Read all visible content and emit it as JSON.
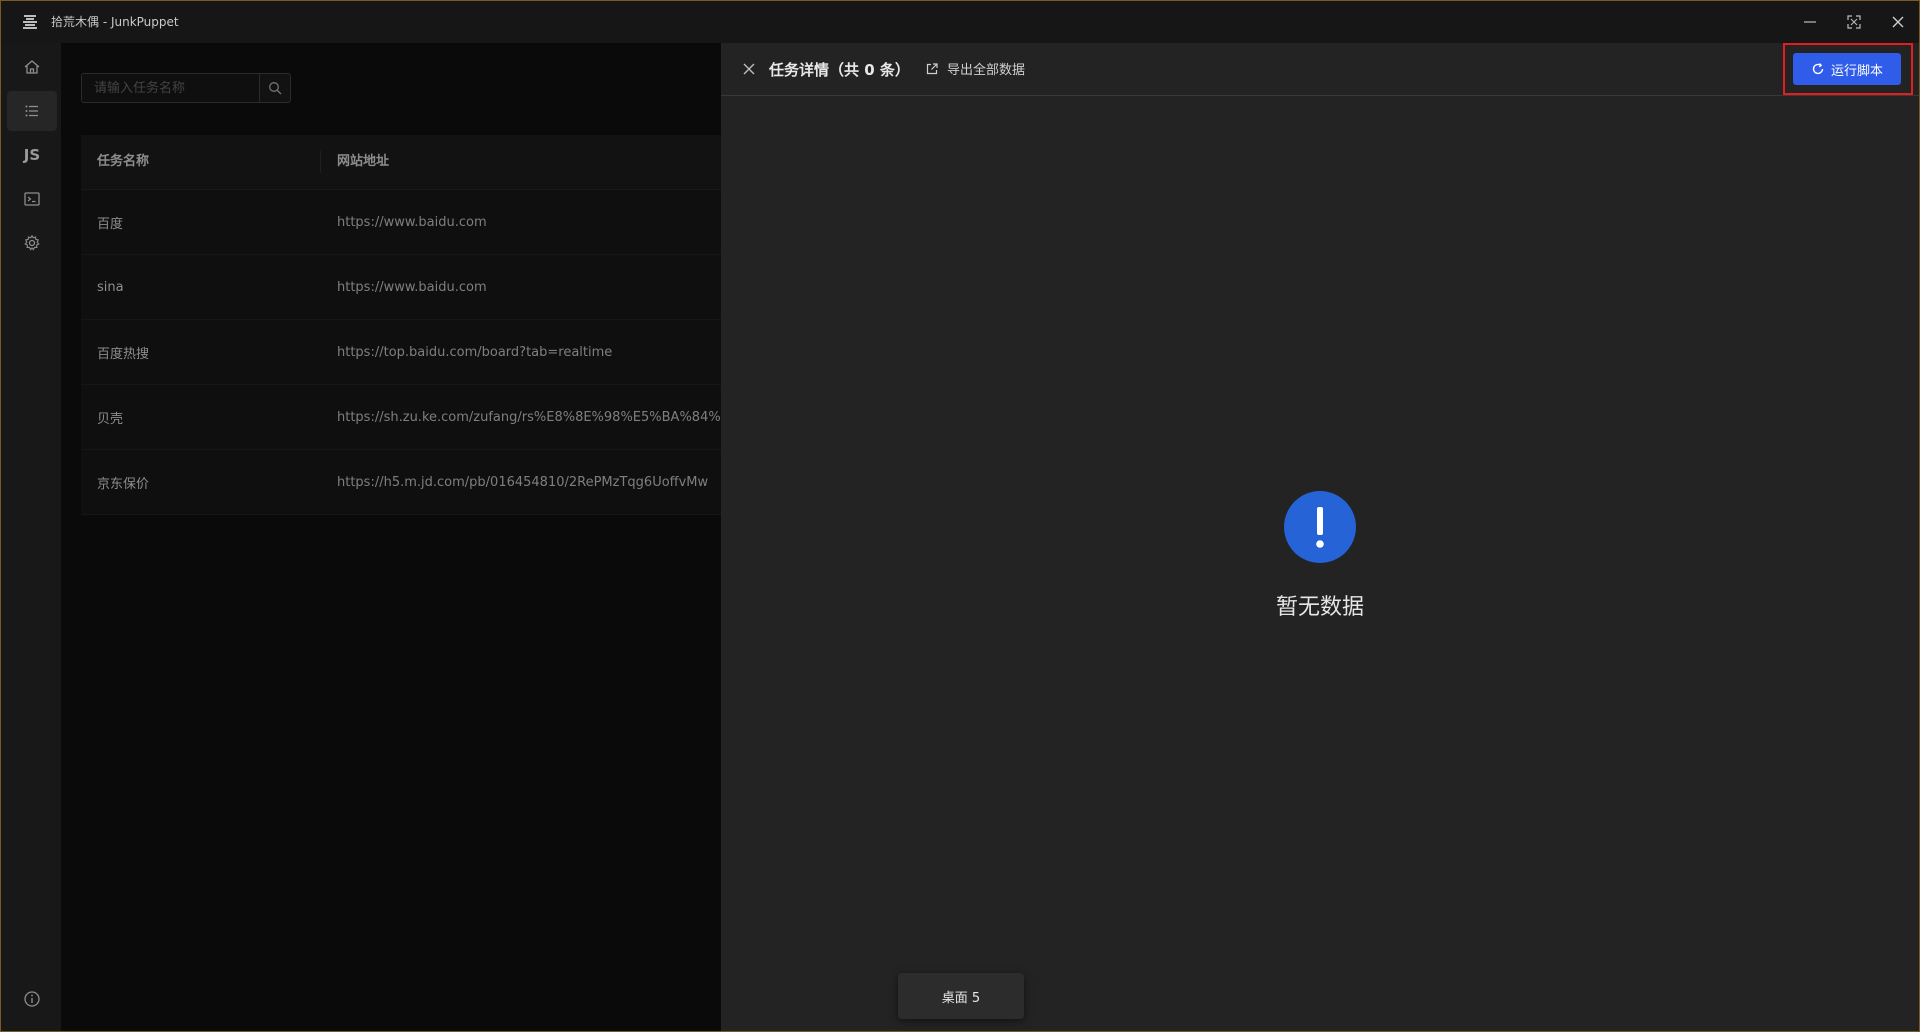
{
  "window": {
    "title": "拾荒木偶 - JunkPuppet"
  },
  "sidebar": {
    "items": [
      {
        "name": "home",
        "icon": "home-icon"
      },
      {
        "name": "task-list",
        "icon": "list-icon",
        "active": true
      },
      {
        "name": "js",
        "label": "JS"
      },
      {
        "name": "terminal",
        "icon": "terminal-icon"
      },
      {
        "name": "settings",
        "icon": "gear-icon"
      }
    ],
    "info_icon": "info-icon"
  },
  "search": {
    "placeholder": "请输入任务名称",
    "value": ""
  },
  "table": {
    "columns": [
      "任务名称",
      "网站地址"
    ],
    "rows": [
      {
        "name": "百度",
        "url": "https://www.baidu.com"
      },
      {
        "name": "sina",
        "url": "https://www.baidu.com"
      },
      {
        "name": "百度热搜",
        "url": "https://top.baidu.com/board?tab=realtime"
      },
      {
        "name": "贝壳",
        "url": "https://sh.zu.ke.com/zufang/rs%E8%8E%98%E5%BA%84%"
      },
      {
        "name": "京东保价",
        "url": "https://h5.m.jd.com/pb/016454810/2RePMzTqg6UoffvMw"
      }
    ]
  },
  "drawer": {
    "title": "任务详情（共 0 条）",
    "export_label": "导出全部数据",
    "run_label": "运行脚本",
    "empty_text": "暂无数据"
  },
  "toast": {
    "text": "桌面 5"
  },
  "colors": {
    "accent": "#2f5ce8",
    "highlight": "#e02020",
    "empty_icon": "#2563d6"
  }
}
